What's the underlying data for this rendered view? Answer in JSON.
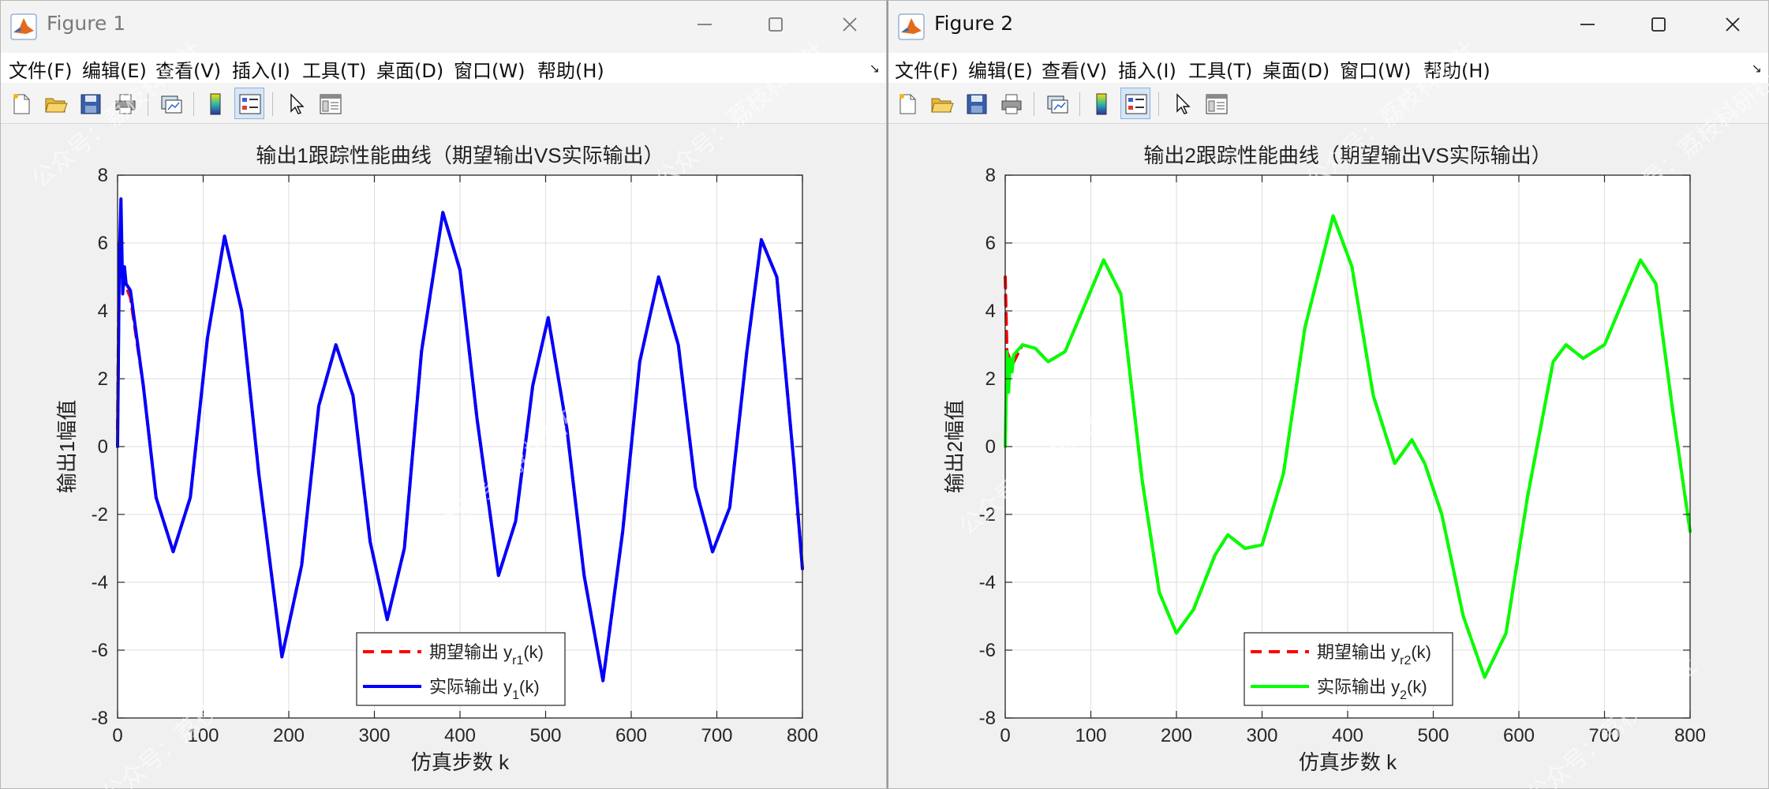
{
  "windows": [
    {
      "title": "Figure 1",
      "menu": [
        "文件(F)",
        "编辑(E)",
        "查看(V)",
        "插入(I)",
        "工具(T)",
        "桌面(D)",
        "窗口(W)",
        "帮助(H)"
      ],
      "axes": {
        "title": "输出1跟踪性能曲线（期望输出VS实际输出）",
        "xlabel": "仿真步数 k",
        "ylabel": "输出1幅值",
        "legend": [
          {
            "text": "期望输出 y",
            "sub": "r1",
            "suffix": "(k)"
          },
          {
            "text": "实际输出 y",
            "sub": "1",
            "suffix": "(k)"
          }
        ]
      }
    },
    {
      "title": "Figure 2",
      "menu": [
        "文件(F)",
        "编辑(E)",
        "查看(V)",
        "插入(I)",
        "工具(T)",
        "桌面(D)",
        "窗口(W)",
        "帮助(H)"
      ],
      "axes": {
        "title": "输出2跟踪性能曲线（期望输出VS实际输出）",
        "xlabel": "仿真步数 k",
        "ylabel": "输出2幅值",
        "legend": [
          {
            "text": "期望输出 y",
            "sub": "r2",
            "suffix": "(k)"
          },
          {
            "text": "实际输出 y",
            "sub": "2",
            "suffix": "(k)"
          }
        ]
      }
    }
  ],
  "watermark_text": "公众号：荔枝科研社",
  "chart_data": [
    {
      "type": "line",
      "title": "输出1跟踪性能曲线（期望输出VS实际输出）",
      "xlabel": "仿真步数 k",
      "ylabel": "输出1幅值",
      "xlim": [
        0,
        800
      ],
      "ylim": [
        -8,
        8
      ],
      "xticks": [
        0,
        100,
        200,
        300,
        400,
        500,
        600,
        700,
        800
      ],
      "yticks": [
        -8,
        -6,
        -4,
        -2,
        0,
        2,
        4,
        6,
        8
      ],
      "grid": true,
      "legend_position": "bottom-center",
      "series": [
        {
          "name": "期望输出 yr1(k)",
          "color": "#ff0000",
          "style": "dashed",
          "x": [
            0,
            2,
            5,
            15,
            30,
            45,
            65,
            85,
            105,
            125,
            145,
            165,
            192,
            215,
            235,
            255,
            275,
            295,
            315,
            335,
            355,
            380,
            400,
            420,
            445,
            465,
            485,
            503,
            525,
            545,
            567,
            590,
            610,
            632,
            655,
            675,
            695,
            715,
            735,
            752,
            770,
            790,
            800
          ],
          "y": [
            0.5,
            6,
            5,
            4.4,
            1.8,
            -1.5,
            -3.1,
            -1.5,
            3.2,
            6.2,
            4.0,
            -0.8,
            -6.2,
            -3.5,
            1.2,
            3.0,
            1.5,
            -2.8,
            -5.1,
            -3.0,
            2.8,
            6.9,
            5.2,
            0.8,
            -3.8,
            -2.2,
            1.8,
            3.8,
            0.5,
            -3.8,
            -6.9,
            -2.5,
            2.5,
            5.0,
            3.0,
            -1.2,
            -3.1,
            -1.8,
            2.8,
            6.1,
            5.0,
            -0.5,
            -3.6
          ]
        },
        {
          "name": "实际输出 y1(k)",
          "color": "#0000ff",
          "style": "solid",
          "x": [
            0,
            2,
            4,
            6,
            8,
            10,
            15,
            30,
            45,
            65,
            85,
            105,
            125,
            145,
            165,
            192,
            215,
            235,
            255,
            275,
            295,
            315,
            335,
            355,
            380,
            400,
            420,
            445,
            465,
            485,
            503,
            525,
            545,
            567,
            590,
            610,
            632,
            655,
            675,
            695,
            715,
            735,
            752,
            770,
            790,
            800
          ],
          "y": [
            0,
            5.5,
            7.3,
            4.5,
            5.3,
            4.8,
            4.6,
            1.8,
            -1.5,
            -3.1,
            -1.5,
            3.2,
            6.2,
            4.0,
            -0.8,
            -6.2,
            -3.5,
            1.2,
            3.0,
            1.5,
            -2.8,
            -5.1,
            -3.0,
            2.8,
            6.9,
            5.2,
            0.8,
            -3.8,
            -2.2,
            1.8,
            3.8,
            0.5,
            -3.8,
            -6.9,
            -2.5,
            2.5,
            5.0,
            3.0,
            -1.2,
            -3.1,
            -1.8,
            2.8,
            6.1,
            5.0,
            -0.5,
            -3.6
          ]
        }
      ]
    },
    {
      "type": "line",
      "title": "输出2跟踪性能曲线（期望输出VS实际输出）",
      "xlabel": "仿真步数 k",
      "ylabel": "输出2幅值",
      "xlim": [
        0,
        800
      ],
      "ylim": [
        -8,
        8
      ],
      "xticks": [
        0,
        100,
        200,
        300,
        400,
        500,
        600,
        700,
        800
      ],
      "yticks": [
        -8,
        -6,
        -4,
        -2,
        0,
        2,
        4,
        6,
        8
      ],
      "grid": true,
      "legend_position": "bottom-center",
      "series": [
        {
          "name": "期望输出 yr2(k)",
          "color": "#ff0000",
          "style": "dashed",
          "x": [
            0,
            2,
            8,
            20,
            35,
            50,
            70,
            90,
            115,
            135,
            160,
            180,
            200,
            220,
            245,
            260,
            280,
            300,
            325,
            350,
            383,
            405,
            430,
            455,
            475,
            490,
            510,
            535,
            560,
            585,
            610,
            640,
            655,
            675,
            700,
            725,
            742,
            760,
            780,
            800
          ],
          "y": [
            5.0,
            2.8,
            2.4,
            3.0,
            2.9,
            2.5,
            2.8,
            4.0,
            5.5,
            4.5,
            -1.0,
            -4.3,
            -5.5,
            -4.8,
            -3.2,
            -2.6,
            -3.0,
            -2.9,
            -0.8,
            3.5,
            6.8,
            5.3,
            1.5,
            -0.5,
            0.2,
            -0.5,
            -2.0,
            -5.0,
            -6.8,
            -5.5,
            -1.5,
            2.5,
            3.0,
            2.6,
            3.0,
            4.5,
            5.5,
            4.8,
            1.0,
            -2.5
          ]
        },
        {
          "name": "实际输出 y2(k)",
          "color": "#00ff00",
          "style": "solid",
          "x": [
            0,
            2,
            4,
            6,
            8,
            10,
            20,
            35,
            50,
            70,
            90,
            115,
            135,
            160,
            180,
            200,
            220,
            245,
            260,
            280,
            300,
            325,
            350,
            383,
            405,
            430,
            455,
            475,
            490,
            510,
            535,
            560,
            585,
            610,
            640,
            655,
            675,
            700,
            725,
            742,
            760,
            780,
            800
          ],
          "y": [
            0,
            2.8,
            1.6,
            2.6,
            2.2,
            2.7,
            3.0,
            2.9,
            2.5,
            2.8,
            4.0,
            5.5,
            4.5,
            -1.0,
            -4.3,
            -5.5,
            -4.8,
            -3.2,
            -2.6,
            -3.0,
            -2.9,
            -0.8,
            3.5,
            6.8,
            5.3,
            1.5,
            -0.5,
            0.2,
            -0.5,
            -2.0,
            -5.0,
            -6.8,
            -5.5,
            -1.5,
            2.5,
            3.0,
            2.6,
            3.0,
            4.5,
            5.5,
            4.8,
            1.0,
            -2.5
          ]
        }
      ]
    }
  ]
}
